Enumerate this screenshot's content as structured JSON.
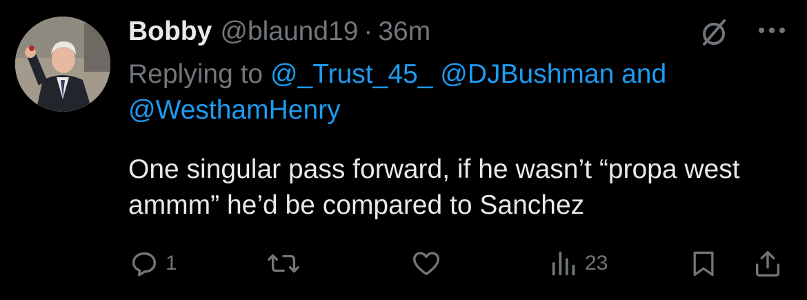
{
  "author": {
    "display_name": "Bobby",
    "handle": "@blaund19",
    "separator": "·",
    "time": "36m"
  },
  "reply": {
    "prefix": "Replying to",
    "mentions": [
      "@_Trust_45_",
      "@DJBushman"
    ],
    "conjunction": "and",
    "last_mention": "@WesthamHenry"
  },
  "tweet": {
    "text": "One singular pass forward, if he wasn’t “propa west ammm” he’d be compared to Sanchez"
  },
  "actions": {
    "reply_count": "1",
    "retweet_count": "",
    "like_count": "",
    "views_count": "23"
  },
  "icons": {
    "grok": "grok-icon",
    "more": "more-dots-icon",
    "reply": "reply-bubble-icon",
    "retweet": "retweet-icon",
    "like": "heart-icon",
    "views": "views-bar-chart-icon",
    "bookmark": "bookmark-icon",
    "share": "share-icon"
  },
  "colors": {
    "background": "#000000",
    "text_primary": "#e7e9ea",
    "text_secondary": "#71767b",
    "link": "#1d9bf0"
  }
}
